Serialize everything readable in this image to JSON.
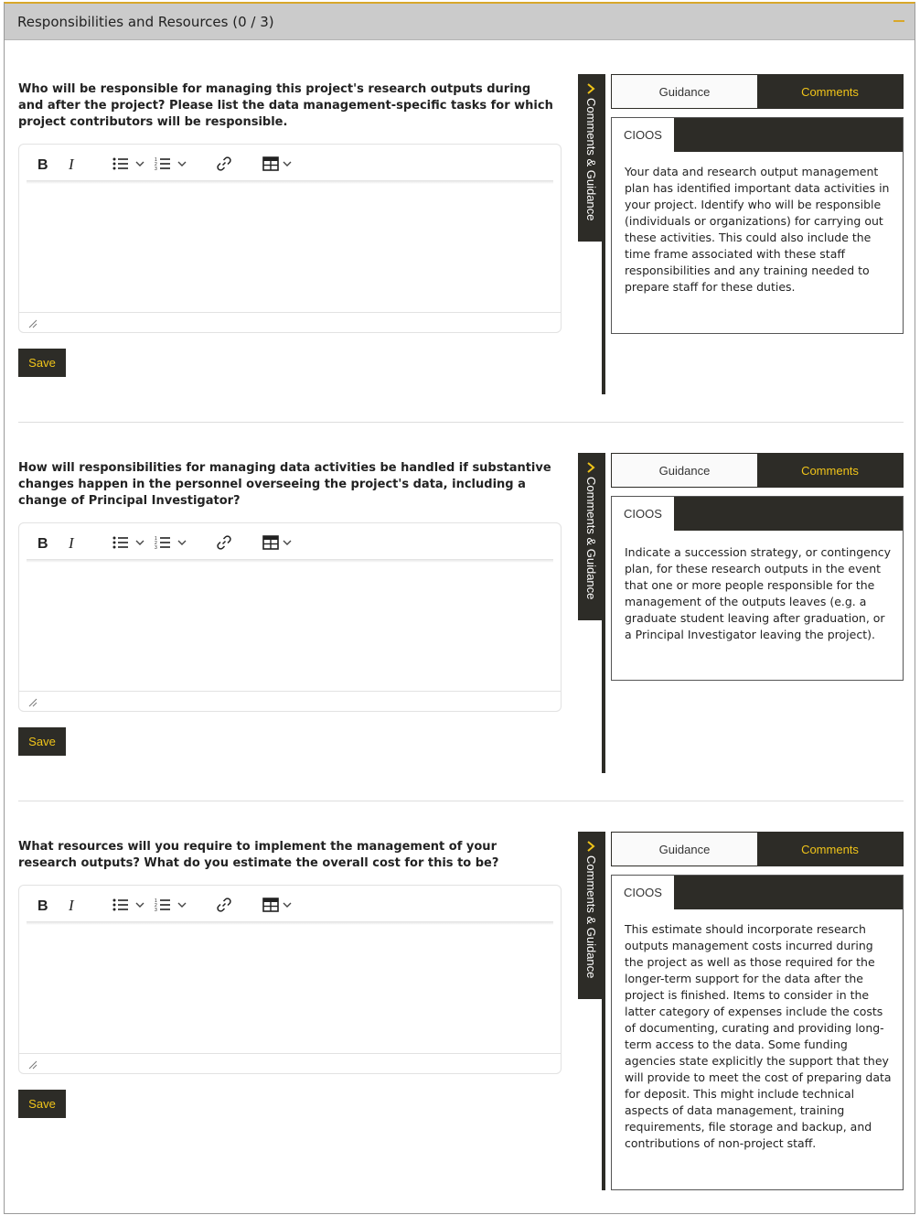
{
  "section": {
    "title": "Responsibilities and Resources (0 / 3)",
    "collapse_icon": "minus-icon",
    "accent_color": "#d8a72a"
  },
  "questions": [
    {
      "text": "Who will be responsible for managing this project's research outputs during and after the project? Please list the data management-specific tasks for which project contributors will be responsible.",
      "save_label": "Save",
      "side_tab_label": "Comments & Guidance",
      "tabs": {
        "guidance": "Guidance",
        "comments": "Comments"
      },
      "org": "CIOOS",
      "guidance": "Your data and research output management plan has identified important data activities in your project. Identify who will be responsible (individuals or organizations) for carrying out these activities. This could also include the time frame associated with these staff responsibilities and any training needed to prepare staff for these duties."
    },
    {
      "text": "How will responsibilities for managing data activities be handled if substantive changes happen in the personnel overseeing the project's data, including a change of Principal Investigator?",
      "save_label": "Save",
      "side_tab_label": "Comments & Guidance",
      "tabs": {
        "guidance": "Guidance",
        "comments": "Comments"
      },
      "org": "CIOOS",
      "guidance": "Indicate a succession strategy, or contingency plan, for these research outputs in the event that one or more people responsible for the management of the outputs leaves (e.g. a graduate student leaving after graduation, or a Principal Investigator leaving the project)."
    },
    {
      "text": "What resources will you require to implement the management of your research outputs? What do you estimate the overall cost for this to be?",
      "save_label": "Save",
      "side_tab_label": "Comments & Guidance",
      "tabs": {
        "guidance": "Guidance",
        "comments": "Comments"
      },
      "org": "CIOOS",
      "guidance": "This estimate should incorporate research outputs management costs incurred during the project as well as those required for the longer-term support for the data after the project is finished. Items to consider in the latter category of expenses include the costs of documenting, curating and providing long-term access to the data. Some funding agencies state explicitly the support that they will provide to meet the cost of preparing data for deposit. This might include technical aspects of data management, training requirements, file storage and backup, and contributions of non-project staff."
    }
  ],
  "toolbar_icons": [
    "bold-icon",
    "italic-icon",
    "bullet-list-icon",
    "numbered-list-icon",
    "link-icon",
    "table-icon"
  ],
  "colors": {
    "dark": "#2d2c27",
    "highlight": "#f0c419",
    "header_bg": "#cbcbcb"
  }
}
